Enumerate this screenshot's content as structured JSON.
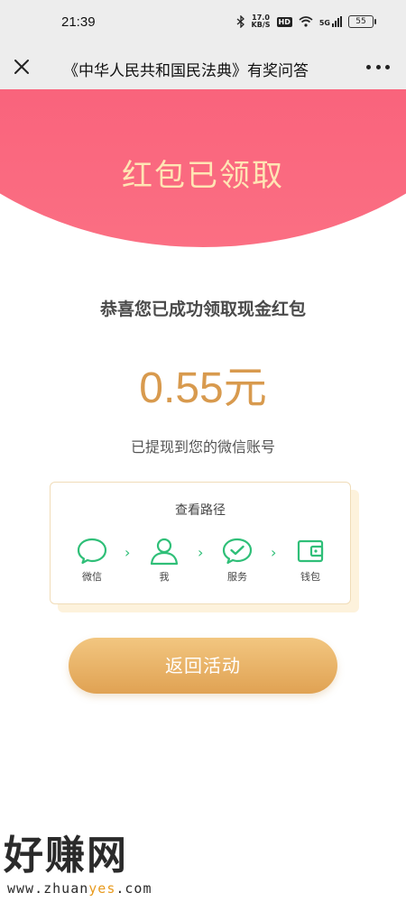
{
  "status_bar": {
    "time": "21:39",
    "speed_value": "17.0",
    "speed_unit": "KB/S",
    "hd": "HD",
    "network": "5G",
    "battery": "55"
  },
  "nav": {
    "title": "《中华人民共和国民法典》有奖问答"
  },
  "banner": {
    "title": "红包已领取"
  },
  "main": {
    "congrats": "恭喜您已成功领取现金红包",
    "amount": "0.55元",
    "withdraw_note": "已提现到您的微信账号"
  },
  "path_card": {
    "title": "查看路径",
    "steps": [
      {
        "label": "微信",
        "icon": "chat-bubble-icon"
      },
      {
        "label": "我",
        "icon": "person-icon"
      },
      {
        "label": "服务",
        "icon": "check-bubble-icon"
      },
      {
        "label": "钱包",
        "icon": "wallet-icon"
      }
    ],
    "arrow": "›"
  },
  "return_button": {
    "label": "返回活动"
  },
  "watermark": {
    "brand": "好赚网",
    "url_prefix": "www.zhuan",
    "url_highlight": "yes",
    "url_suffix": ".com"
  },
  "colors": {
    "banner": "#f2456a",
    "banner_title": "#ffe5b4",
    "amount": "#d89a4e",
    "button": "#e0a253",
    "icon_green": "#2fbf78"
  }
}
